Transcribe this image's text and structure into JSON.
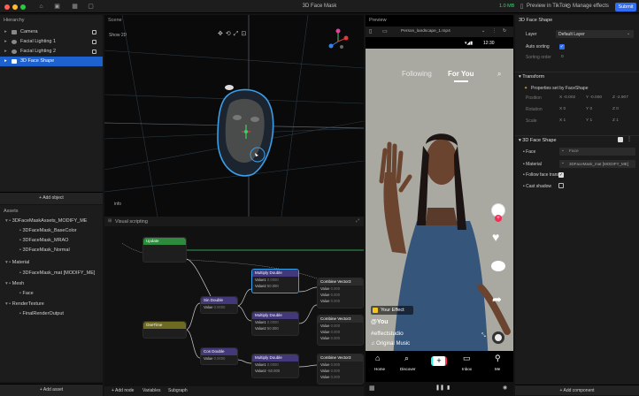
{
  "window": {
    "title": "3D Face Mask",
    "camera_label": "1.0 MB",
    "preview_tiktok": "Preview in TikTok",
    "manage_effects": "Manage effects",
    "submit": "Submit"
  },
  "hierarchy": {
    "title": "Hierarchy",
    "items": [
      {
        "label": "Camera",
        "selected": false
      },
      {
        "label": "Facial Lighting 1",
        "selected": false
      },
      {
        "label": "Facial Lighting 2",
        "selected": false
      },
      {
        "label": "3D Face Shape",
        "selected": true
      }
    ],
    "add_object": "+ Add object"
  },
  "assets": {
    "title": "Assets",
    "items": [
      {
        "label": "3DFaceMaskAssets_MODIFY_ME",
        "indent": 0,
        "type": "folder"
      },
      {
        "label": "3DFaceMask_BaseColor",
        "indent": 1,
        "type": "file"
      },
      {
        "label": "3DFaceMask_MRAO",
        "indent": 1,
        "type": "file"
      },
      {
        "label": "3DFaceMask_Normal",
        "indent": 1,
        "type": "file"
      },
      {
        "label": "Material",
        "indent": 0,
        "type": "folder"
      },
      {
        "label": "3DFaceMask_mat [MODIFY_ME]",
        "indent": 1,
        "type": "file"
      },
      {
        "label": "Mesh",
        "indent": 0,
        "type": "folder"
      },
      {
        "label": "Face",
        "indent": 1,
        "type": "file"
      },
      {
        "label": "RenderTexture",
        "indent": 0,
        "type": "folder"
      },
      {
        "label": "FinalRenderOutput",
        "indent": 1,
        "type": "file"
      }
    ],
    "add_asset": "+ Add asset"
  },
  "scene": {
    "title": "Scene",
    "mode": "Show 2D",
    "info": "info"
  },
  "visual": {
    "title": "Visual scripting",
    "tabs": [
      "+ Add node",
      "Variables",
      "Subgraph"
    ],
    "nodes": {
      "update": {
        "title": "Update"
      },
      "onetime": {
        "title": "OneTime"
      },
      "sin1": {
        "title": "Sin Double",
        "row": "Value",
        "val": "0.0000"
      },
      "cos1": {
        "title": "Cos Double",
        "row": "Value",
        "val": "0.0000"
      },
      "mul1": {
        "title": "Multiply Double",
        "r1": "Value1",
        "v1": "0.0000",
        "r2": "Value2",
        "v2": "50.000"
      },
      "mul2": {
        "title": "Multiply Double",
        "r1": "Value1",
        "v1": "0.0000",
        "r2": "Value2",
        "v2": "50.000"
      },
      "mul3": {
        "title": "Multiply Double",
        "r1": "Value1",
        "v1": "0.0000",
        "r2": "Value2",
        "v2": "-50.000"
      },
      "comb1": {
        "title": "Combine Vector3",
        "rows": [
          "Value",
          "Value",
          "Value"
        ],
        "vals": [
          "0.000",
          "0.000",
          "0.000"
        ]
      },
      "comb2": {
        "title": "Combine Vector3",
        "rows": [
          "Value",
          "Value",
          "Value"
        ],
        "vals": [
          "0.000",
          "0.000",
          "0.000"
        ]
      },
      "comb3": {
        "title": "Combine Vector3",
        "rows": [
          "Value",
          "Value",
          "Value"
        ],
        "vals": [
          "0.000",
          "0.000",
          "0.000"
        ]
      }
    }
  },
  "preview": {
    "title": "Preview",
    "file": "Person_landscape_1.mp4",
    "time": "12:30",
    "tabs": [
      "Following",
      "For You"
    ],
    "effect": "Your Effect",
    "user": "@You",
    "hashtag": "#effectstudio",
    "music": "Original Music",
    "nav": [
      "Home",
      "Discover",
      "",
      "Inbox",
      "Me"
    ]
  },
  "inspector": {
    "title": "3D Face Shape",
    "layer_label": "Layer",
    "layer_value": "Default Layer",
    "auto_sorting": "Auto sorting",
    "sorting_order": "Sorting order",
    "sorting_value": "0",
    "transform": "Transform",
    "properties_set": "Properties set by FaceShape",
    "position": "Position",
    "rotation": "Rotation",
    "scale": "Scale",
    "pos_vals": [
      "-0.002",
      "-0.000",
      "-2.907"
    ],
    "rot_vals": [
      "0",
      "0",
      "0"
    ],
    "scale_vals": [
      "1",
      "1",
      "1"
    ],
    "section": "3D Face Shape",
    "face_label": "Face",
    "face_value": "Face",
    "material_label": "Material",
    "material_value": "3DFaceMask_mat [MODIFY_ME]",
    "follow": "Follow face transf",
    "cast": "Cast shadow",
    "add_component": "+ Add component"
  },
  "colors": {
    "accent": "#2f6df5",
    "select": "#1e62d0",
    "update_node": "#2e8b3e",
    "onetime_node": "#7a7a2a",
    "math_node": "#4b3a8a",
    "combine_node": "#2a2a2a"
  }
}
